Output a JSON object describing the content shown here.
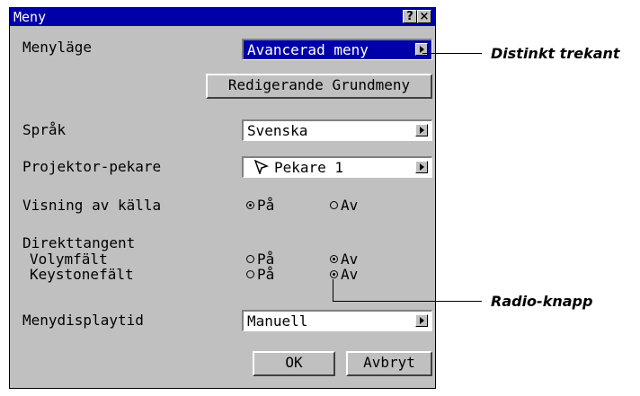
{
  "dialog": {
    "title": "Meny",
    "help_glyph": "?",
    "close_glyph": "×"
  },
  "menu_mode": {
    "label": "Menyläge",
    "value": "Avancerad meny",
    "edit_button": "Redigerande Grundmeny"
  },
  "language": {
    "label": "Språk",
    "value": "Svenska"
  },
  "pointer": {
    "label": "Projektor-pekare",
    "value": "Pekare 1",
    "icon": "mouse-pointer-icon"
  },
  "source_display": {
    "label": "Visning av källa",
    "on_label": "På",
    "off_label": "Av",
    "selected": "on"
  },
  "direct_key": {
    "heading": "Direkttangent",
    "volume": {
      "label": "Volymfält",
      "on_label": "På",
      "off_label": "Av",
      "selected": "off"
    },
    "keystone": {
      "label": "Keystonefält",
      "on_label": "På",
      "off_label": "Av",
      "selected": "off"
    }
  },
  "display_time": {
    "label": "Menydisplaytid",
    "value": "Manuell"
  },
  "buttons": {
    "ok": "OK",
    "cancel": "Avbryt"
  },
  "callouts": {
    "triangle": "Distinkt trekant",
    "radio": "Radio-knapp"
  },
  "colors": {
    "title_bar": "#0000a8",
    "dialog_bg": "#c0c0c0",
    "selected_field": "#0000a8"
  }
}
